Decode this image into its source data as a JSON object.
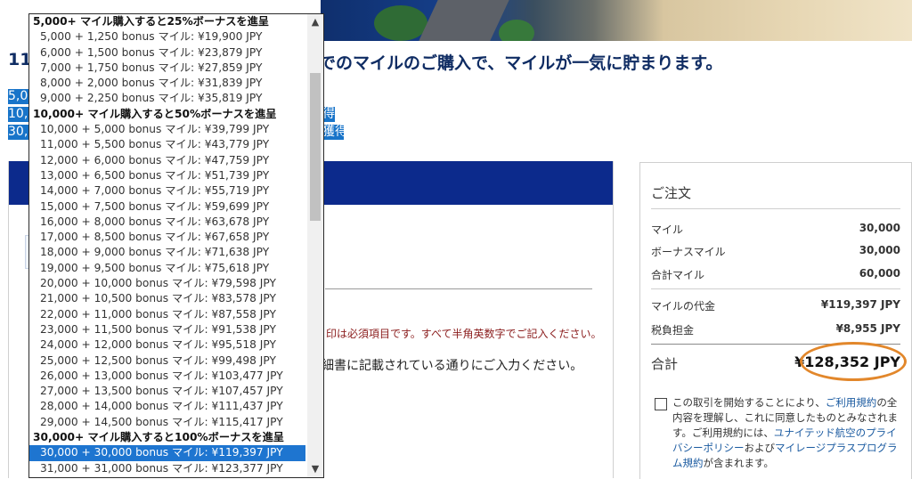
{
  "headline": {
    "lead": "11",
    "rest": "でのマイルのご購入で、マイルが一気に貯まります。"
  },
  "highlight_rows": [
    {
      "left": "5,0",
      "right": ""
    },
    {
      "left": "10,",
      "right": "得"
    },
    {
      "left": "30,",
      "right": "獲得"
    }
  ],
  "form": {
    "required_note": "印は必須項目です。すべて半角英数字でご記入ください。",
    "card_note": "細書に記載されている通りにご入力ください。"
  },
  "order": {
    "title": "ご注文",
    "rows": [
      {
        "label": "マイル",
        "value": "30,000"
      },
      {
        "label": "ボーナスマイル",
        "value": "30,000"
      },
      {
        "label": "合計マイル",
        "value": "60,000"
      },
      {
        "label": "マイルの代金",
        "value": "¥119,397 JPY"
      },
      {
        "label": "税負担金",
        "value": "¥8,955 JPY"
      }
    ],
    "total_label": "合計",
    "total_value": "¥128,352 JPY",
    "agree": {
      "t1": "この取引を開始することにより、",
      "l1": "ご利用規約",
      "t2": "の全内容を理解し、これに同意したものとみなされます。ご利用規約には、",
      "l2": "ユナイテッド航空のプライバシーポリシー",
      "t3": "および",
      "l3": "マイレージプラスプログラム規約",
      "t4": "が含まれます。"
    }
  },
  "dropdown": {
    "scroll_up_icon": "▲",
    "scroll_down_icon": "▼",
    "items": [
      {
        "label": "5,000+ マイル購入すると25%ボーナスを進呈",
        "group": true
      },
      {
        "label": "5,000 + 1,250 bonus マイル: ¥19,900 JPY"
      },
      {
        "label": "6,000 + 1,500 bonus マイル: ¥23,879 JPY"
      },
      {
        "label": "7,000 + 1,750 bonus マイル: ¥27,859 JPY"
      },
      {
        "label": "8,000 + 2,000 bonus マイル: ¥31,839 JPY"
      },
      {
        "label": "9,000 + 2,250 bonus マイル: ¥35,819 JPY"
      },
      {
        "label": "10,000+ マイル購入すると50%ボーナスを進呈",
        "group": true
      },
      {
        "label": "10,000 + 5,000 bonus マイル: ¥39,799 JPY"
      },
      {
        "label": "11,000 + 5,500 bonus マイル: ¥43,779 JPY"
      },
      {
        "label": "12,000 + 6,000 bonus マイル: ¥47,759 JPY"
      },
      {
        "label": "13,000 + 6,500 bonus マイル: ¥51,739 JPY"
      },
      {
        "label": "14,000 + 7,000 bonus マイル: ¥55,719 JPY"
      },
      {
        "label": "15,000 + 7,500 bonus マイル: ¥59,699 JPY"
      },
      {
        "label": "16,000 + 8,000 bonus マイル: ¥63,678 JPY"
      },
      {
        "label": "17,000 + 8,500 bonus マイル: ¥67,658 JPY"
      },
      {
        "label": "18,000 + 9,000 bonus マイル: ¥71,638 JPY"
      },
      {
        "label": "19,000 + 9,500 bonus マイル: ¥75,618 JPY"
      },
      {
        "label": "20,000 + 10,000 bonus マイル: ¥79,598 JPY"
      },
      {
        "label": "21,000 + 10,500 bonus マイル: ¥83,578 JPY"
      },
      {
        "label": "22,000 + 11,000 bonus マイル: ¥87,558 JPY"
      },
      {
        "label": "23,000 + 11,500 bonus マイル: ¥91,538 JPY"
      },
      {
        "label": "24,000 + 12,000 bonus マイル: ¥95,518 JPY"
      },
      {
        "label": "25,000 + 12,500 bonus マイル: ¥99,498 JPY"
      },
      {
        "label": "26,000 + 13,000 bonus マイル: ¥103,477 JPY"
      },
      {
        "label": "27,000 + 13,500 bonus マイル: ¥107,457 JPY"
      },
      {
        "label": "28,000 + 14,000 bonus マイル: ¥111,437 JPY"
      },
      {
        "label": "29,000 + 14,500 bonus マイル: ¥115,417 JPY"
      },
      {
        "label": "30,000+ マイル購入すると100%ボーナスを進呈",
        "group": true
      },
      {
        "label": "30,000 + 30,000 bonus マイル: ¥119,397 JPY",
        "selected": true
      },
      {
        "label": "31,000 + 31,000 bonus マイル: ¥123,377 JPY"
      }
    ]
  }
}
